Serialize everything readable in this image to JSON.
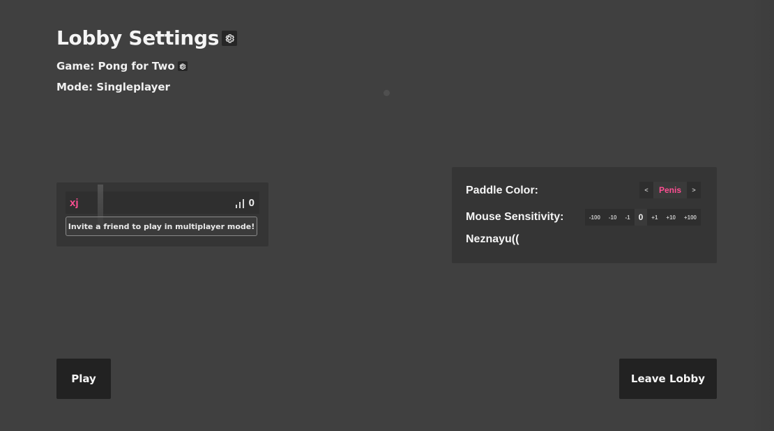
{
  "header": {
    "title": "Lobby Settings",
    "title_icon": "gear-icon",
    "game_label": "Game:",
    "game_value": "Pong for Two",
    "game_icon": "gear-icon",
    "mode_label": "Mode:",
    "mode_value": "Singleplayer"
  },
  "player_panel": {
    "player_name": "xj",
    "ping_icon": "signal-bars-icon",
    "ping_value": "0",
    "invite_button_label": "Invite a friend to play in multiplayer mode!"
  },
  "settings_panel": {
    "paddle_color_label": "Paddle Color:",
    "paddle_color_prev": "<",
    "paddle_color_value": "Penis",
    "paddle_color_next": ">",
    "mouse_sensitivity_label": "Mouse Sensitivity:",
    "sensitivity_buttons_minus": [
      "-100",
      "-10",
      "-1"
    ],
    "sensitivity_value": "0",
    "sensitivity_buttons_plus": [
      "+1",
      "+10",
      "+100"
    ],
    "extra_label": "Neznayu(("
  },
  "actions": {
    "play_label": "Play",
    "leave_label": "Leave Lobby"
  },
  "colors": {
    "background": "#404040",
    "panel": "#353535",
    "accent_pink": "#ff4f93",
    "button_dark": "#222222"
  }
}
